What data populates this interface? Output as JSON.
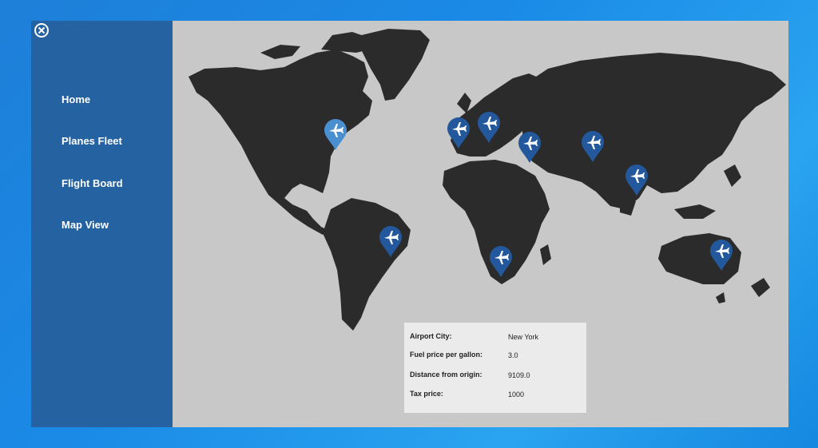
{
  "sidebar": {
    "items": [
      {
        "label": "Home"
      },
      {
        "label": "Planes Fleet"
      },
      {
        "label": "Flight Board"
      },
      {
        "label": "Map View"
      }
    ]
  },
  "colors": {
    "sidebar": "#2562a1",
    "map_background": "#c8c8c8",
    "land": "#2b2b2b",
    "pin_active": "#4a90d0",
    "pin": "#23589c"
  },
  "pins": [
    {
      "city": "New York",
      "selected": true
    },
    {
      "city": "",
      "selected": false
    },
    {
      "city": "",
      "selected": false
    },
    {
      "city": "",
      "selected": false
    },
    {
      "city": "",
      "selected": false
    },
    {
      "city": "",
      "selected": false
    },
    {
      "city": "",
      "selected": false
    },
    {
      "city": "",
      "selected": false
    },
    {
      "city": "",
      "selected": false
    }
  ],
  "info": {
    "airport_city_label": "Airport City:",
    "airport_city_value": "New York",
    "fuel_label": "Fuel price per gallon:",
    "fuel_value": "3.0",
    "distance_label": "Distance from origin:",
    "distance_value": "9109.0",
    "tax_label": "Tax price:",
    "tax_value": "1000"
  }
}
